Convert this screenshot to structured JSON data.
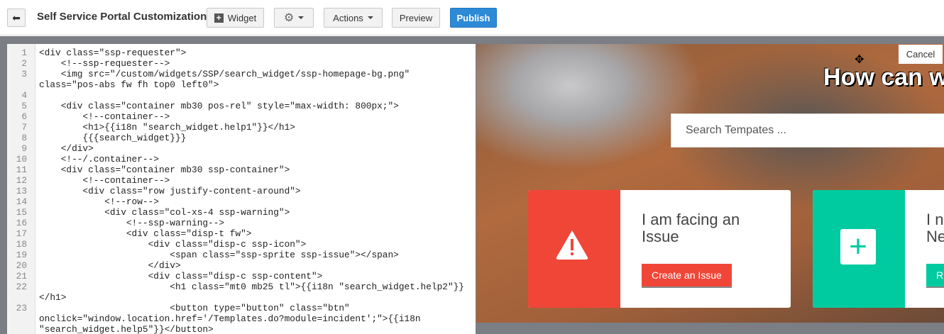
{
  "toolbar": {
    "title": "Self Service Portal Customization",
    "widget": "Widget",
    "actions": "Actions",
    "preview": "Preview",
    "publish": "Publish"
  },
  "editor": {
    "lines": [
      {
        "n": "1",
        "t": "<div class=\"ssp-requester\">"
      },
      {
        "n": "2",
        "t": "    <!--ssp-requester-->"
      },
      {
        "n": "3",
        "t": "    <img src=\"/custom/widgets/SSP/search_widget/ssp-homepage-bg.png\""
      },
      {
        "n": "",
        "t": "class=\"pos-abs fw fh top0 left0\">"
      },
      {
        "n": "4",
        "t": ""
      },
      {
        "n": "5",
        "t": "    <div class=\"container mb30 pos-rel\" style=\"max-width: 800px;\">"
      },
      {
        "n": "6",
        "t": "        <!--container-->"
      },
      {
        "n": "7",
        "t": "        <h1>{{i18n \"search_widget.help1\"}}</h1>"
      },
      {
        "n": "8",
        "t": "        {{{search_widget}}}"
      },
      {
        "n": "9",
        "t": "    </div>"
      },
      {
        "n": "10",
        "t": "    <!--/.container-->"
      },
      {
        "n": "11",
        "t": "    <div class=\"container mb30 ssp-container\">"
      },
      {
        "n": "12",
        "t": "        <!--container-->"
      },
      {
        "n": "13",
        "t": "        <div class=\"row justify-content-around\">"
      },
      {
        "n": "14",
        "t": "            <!--row-->"
      },
      {
        "n": "15",
        "t": "            <div class=\"col-xs-4 ssp-warning\">"
      },
      {
        "n": "16",
        "t": "                <!--ssp-warning-->"
      },
      {
        "n": "17",
        "t": "                <div class=\"disp-t fw\">"
      },
      {
        "n": "18",
        "t": "                    <div class=\"disp-c ssp-icon\">"
      },
      {
        "n": "19",
        "t": "                        <span class=\"ssp-sprite ssp-issue\"></span>"
      },
      {
        "n": "20",
        "t": "                    </div>"
      },
      {
        "n": "21",
        "t": "                    <div class=\"disp-c ssp-content\">"
      },
      {
        "n": "22",
        "t": "                        <h1 class=\"mt0 mb25 tl\">{{i18n \"search_widget.help2\"}}"
      },
      {
        "n": "",
        "t": "</h1>"
      },
      {
        "n": "23",
        "t": "                        <button type=\"button\" class=\"btn\""
      },
      {
        "n": "",
        "t": "onclick=\"window.location.href='/Templates.do?module=incident';\">{{i18n"
      },
      {
        "n": "",
        "t": "\"search_widget.help5\"}}</button>"
      }
    ]
  },
  "preview": {
    "cancel": "Cancel",
    "heading": "How can we",
    "search_placeholder": "Search Tempates ...",
    "card1": {
      "title": "I am facing an\nIssue",
      "button": "Create an Issue",
      "color": "#f04638"
    },
    "card2": {
      "title": "I n\nNe",
      "button": "R",
      "color": "#00cba0"
    }
  }
}
